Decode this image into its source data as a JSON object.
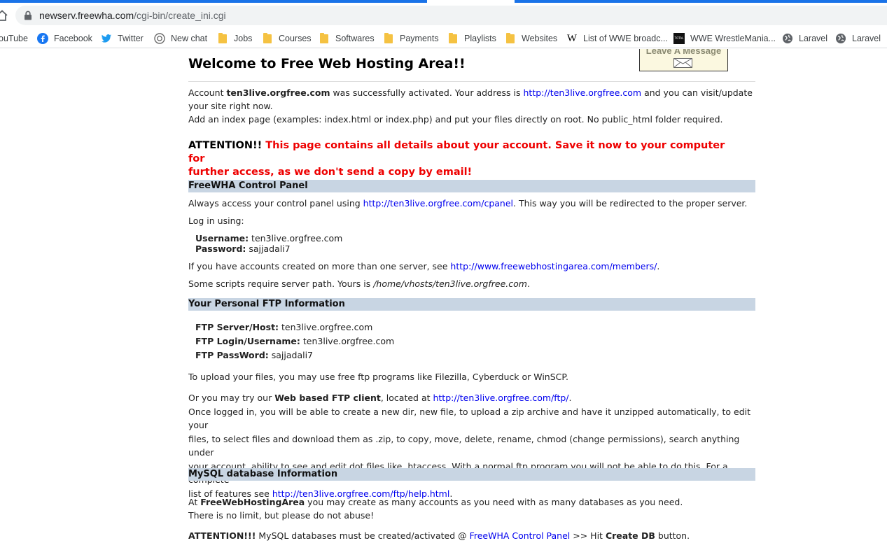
{
  "browser": {
    "url_host": "newserv.freewha.com",
    "url_path": "/cgi-bin/create_ini.cgi",
    "bookmarks": [
      {
        "label": "ouTube",
        "icon": "youtube-icon"
      },
      {
        "label": "Facebook",
        "icon": "facebook-icon"
      },
      {
        "label": "Twitter",
        "icon": "twitter-icon"
      },
      {
        "label": "New chat",
        "icon": "openai-icon"
      },
      {
        "label": "Jobs",
        "icon": "folder-icon"
      },
      {
        "label": "Courses",
        "icon": "folder-icon"
      },
      {
        "label": "Softwares",
        "icon": "folder-icon"
      },
      {
        "label": "Payments",
        "icon": "folder-icon"
      },
      {
        "label": "Playlists",
        "icon": "folder-icon"
      },
      {
        "label": "Websites",
        "icon": "folder-icon"
      },
      {
        "label": "List of WWE broadc...",
        "icon": "wikipedia-icon"
      },
      {
        "label": "WWE WrestleMania...",
        "icon": "total-icon"
      },
      {
        "label": "Laravel",
        "icon": "globe-icon"
      },
      {
        "label": "Laravel",
        "icon": "globe-icon"
      }
    ],
    "accent": "#1a73e8"
  },
  "banner": {
    "text": "Leave A Message"
  },
  "page": {
    "title": "Welcome to Free Web Hosting Area!!",
    "intro": {
      "p1_a": "Account ",
      "account": "ten3live.orgfree.com",
      "p1_b": " was successfully activated. Your address is ",
      "address_link": "http://ten3live.orgfree.com",
      "p1_c": " and you can visit/update",
      "p1_d": "your site right now.",
      "p2": "Add an index page (examples: index.html or index.php) and put your files directly on root. No public_html folder required."
    },
    "attention": {
      "label": "ATTENTION!!",
      "text1": " This page contains all details about your account. Save it now to your computer for",
      "text2": "further access, as we don't send a copy by email!"
    },
    "control_panel": {
      "heading": "FreeWHA Control Panel",
      "line_a": "Always access your control panel using ",
      "cpanel_link": "http://ten3live.orgfree.com/cpanel",
      "line_b": ". This way you will be redirected to the proper server.",
      "login_text": "Log in using:",
      "username_label": "Username:",
      "username": " ten3live.orgfree.com",
      "password_label": "Password:",
      "password": " sajjadali7",
      "members_a": "If you have accounts created on more than one server, see ",
      "members_link": "http://www.freewebhostingarea.com/members/",
      "members_b": ".",
      "path_a": "Some scripts require server path. Yours is ",
      "path": "/home/vhosts/ten3live.orgfree.com",
      "path_b": "."
    },
    "ftp": {
      "heading": "Your Personal FTP Information",
      "server_label": "FTP Server/Host:",
      "server": " ten3live.orgfree.com",
      "login_label": "FTP Login/Username:",
      "login": " ten3live.orgfree.com",
      "pass_label": "FTP PassWord:",
      "pass": " sajjadali7",
      "upload": "To upload your files, you may use free ftp programs like Filezilla, Cyberduck or WinSCP.",
      "web_a": "Or you may try our ",
      "web_bold": "Web based FTP client",
      "web_b": ", located at ",
      "web_link": "http://ten3live.orgfree.com/ftp/",
      "web_c": ".",
      "desc1": "Once logged in, you will be able to create a new dir, new file, to upload a zip archive and have it unzipped automatically, to edit your",
      "desc2": "files, to select files and download them as .zip, to copy, move, delete, rename, chmod (change permissions), search anything under",
      "desc3": "your account, ability to see and edit dot files like .htaccess. With a normal ftp program you will not be able to do this. For a complete",
      "desc4_a": "list of features see ",
      "help_link": "http://ten3live.orgfree.com/ftp/help.html",
      "desc4_b": "."
    },
    "mysql": {
      "heading": "MySQL database Information",
      "l1_a": "At ",
      "l1_bold": "FreeWebHostingArea",
      "l1_b": " you may create as many accounts as you need with as many databases as you need.",
      "l2": "There is no limit, but please do not abuse!",
      "att_label": "ATTENTION!!!",
      "att_a": " MySQL databases must be created/activated @ ",
      "att_link": "FreeWHA Control Panel",
      "att_b": " >> Hit ",
      "att_bold": "Create DB",
      "att_c": " button."
    }
  }
}
